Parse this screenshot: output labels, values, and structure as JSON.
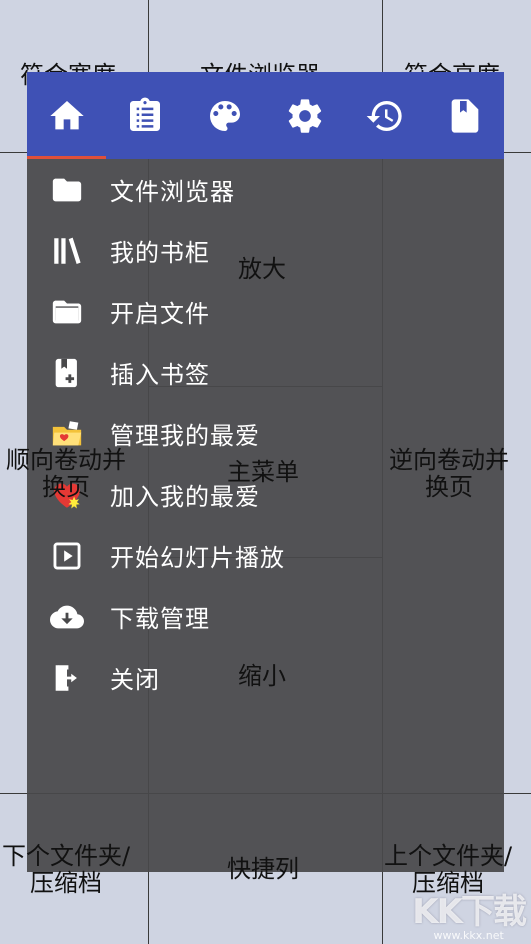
{
  "hints": {
    "top_left": "符合宽度",
    "top_center": "文件浏览器",
    "top_right": "符合高度",
    "mid_left_1": "顺向卷动并",
    "mid_left_2": "换页",
    "mid_center": "主菜单",
    "mid_right_1": "逆向卷动并",
    "mid_right_2": "换页",
    "zoom_in": "放大",
    "zoom_out": "缩小",
    "bottom_left_1": "下个文件夹/",
    "bottom_left_2": "压缩档",
    "bottom_center": "快捷列",
    "bottom_right_1": "上个文件夹/",
    "bottom_right_2": "压缩档"
  },
  "tabs": [
    {
      "icon": "home-icon"
    },
    {
      "icon": "clipboard-icon"
    },
    {
      "icon": "palette-icon"
    },
    {
      "icon": "gear-icon"
    },
    {
      "icon": "history-icon"
    },
    {
      "icon": "bookmark-page-icon"
    }
  ],
  "menu": {
    "items": [
      {
        "label": "文件浏览器",
        "icon": "folder-icon"
      },
      {
        "label": "我的书柜",
        "icon": "bookshelf-icon"
      },
      {
        "label": "开启文件",
        "icon": "open-folder-icon"
      },
      {
        "label": "插入书签",
        "icon": "add-bookmark-icon"
      },
      {
        "label": "管理我的最爱",
        "icon": "favorites-folder-icon"
      },
      {
        "label": "加入我的最爱",
        "icon": "heart-add-icon"
      },
      {
        "label": "开始幻灯片播放",
        "icon": "play-icon"
      },
      {
        "label": "下载管理",
        "icon": "cloud-download-icon"
      },
      {
        "label": "关闭",
        "icon": "exit-icon"
      }
    ]
  },
  "watermark": {
    "logo": "KK下载",
    "url": "www.kkx.net"
  },
  "colors": {
    "topbar": "#3f51b5",
    "indicator": "#e0503a",
    "drawer": "#48484a",
    "background": "#cfd4e2"
  }
}
